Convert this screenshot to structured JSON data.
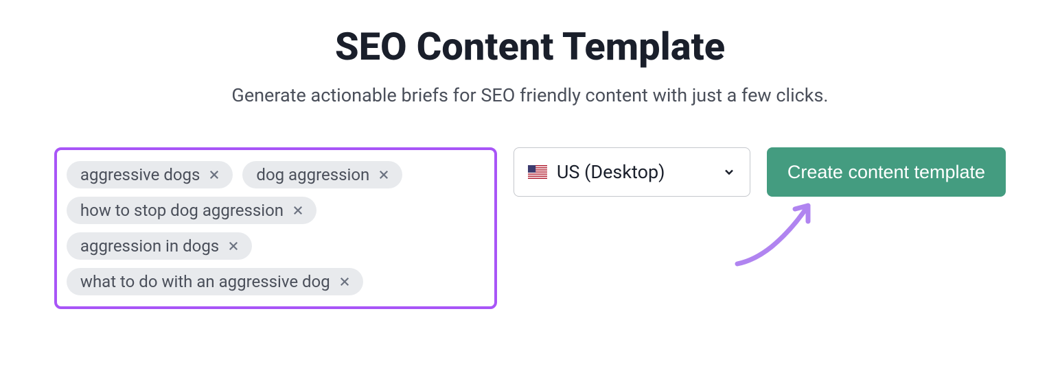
{
  "header": {
    "title": "SEO Content Template",
    "subtitle": "Generate actionable briefs for SEO friendly content with just a few clicks."
  },
  "tags": [
    {
      "label": "aggressive dogs"
    },
    {
      "label": "dog aggression"
    },
    {
      "label": "how to stop dog aggression"
    },
    {
      "label": "aggression in dogs"
    },
    {
      "label": "what to do with an aggressive dog"
    }
  ],
  "region": {
    "selected_label": "US (Desktop)",
    "flag": "us-flag"
  },
  "actions": {
    "create_label": "Create content template"
  },
  "colors": {
    "accent_highlight": "#a855f7",
    "button_bg": "#449c80"
  }
}
